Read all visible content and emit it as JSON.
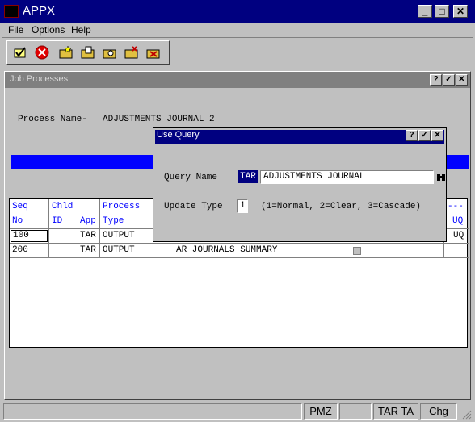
{
  "app": {
    "title": "APPX"
  },
  "window_controls": {
    "minimize": "_",
    "maximize": "□",
    "close": "✕"
  },
  "menu": {
    "items": [
      "File",
      "Options",
      "Help"
    ]
  },
  "toolbar": {
    "icons": [
      "check-icon",
      "cancel-icon",
      "folder-new-icon",
      "folder-edit-icon",
      "folder-find-icon",
      "folder-delete-icon",
      "folder-cancel-icon"
    ]
  },
  "inner_window": {
    "title": "Job Processes",
    "process_label": "Process Name-",
    "process_name": "ADJUSTMENTS JOURNAL 2",
    "controls": {
      "help": "?",
      "ok": "✓",
      "close": "✕"
    }
  },
  "grid": {
    "headers": {
      "seq": [
        "Seq",
        "No"
      ],
      "chld": [
        "Chld",
        "ID"
      ],
      "app": [
        "",
        "App"
      ],
      "process": [
        "Process",
        "Type"
      ],
      "uq": [
        "---",
        "UQ"
      ]
    },
    "rows": [
      {
        "seq": "100",
        "chld": "",
        "app": "TAR",
        "type": "OUTPUT",
        "name": "",
        "uq": "UQ"
      },
      {
        "seq": "200",
        "chld": "",
        "app": "TAR",
        "type": "OUTPUT",
        "name": "AR JOURNALS SUMMARY",
        "uq": ""
      }
    ]
  },
  "dialog": {
    "title": "Use Query",
    "controls": {
      "help": "?",
      "ok": "✓",
      "close": "✕"
    },
    "query_label": "Query Name",
    "query_app": "TAR",
    "query_value": "ADJUSTMENTS JOURNAL",
    "update_label": "Update Type",
    "update_value": "1",
    "update_hint": "(1=Normal, 2=Clear, 3=Cascade)"
  },
  "status": {
    "pane2": "PMZ",
    "pane4": "TAR TA",
    "pane5": "Chg"
  },
  "colors": {
    "title_bar": "#000080",
    "highlight_bar": "#0000ff",
    "inactive_title": "#808080"
  }
}
